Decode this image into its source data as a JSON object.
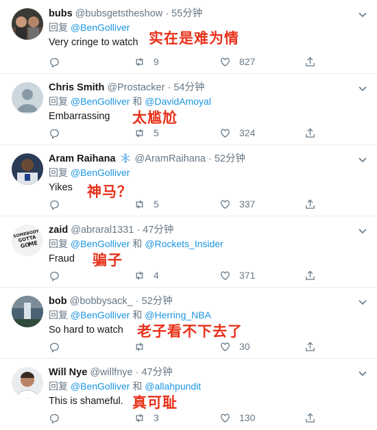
{
  "reply_prefix": "回复",
  "and_word": "和",
  "tweets": [
    {
      "name": "bubs",
      "handle": "@bubsgetstheshow",
      "time": "55分钟",
      "reply_to": [
        "@BenGolliver"
      ],
      "text": "Very cringe to watch",
      "overlay": "实在是难为情",
      "retweets": "9",
      "likes": "827"
    },
    {
      "name": "Chris Smith",
      "handle": "@Prostacker",
      "time": "54分钟",
      "reply_to": [
        "@BenGolliver",
        "@DavidAmoyal"
      ],
      "text": "Embarrassing",
      "overlay": "太尴尬",
      "retweets": "5",
      "likes": "324"
    },
    {
      "name": "Aram Raihana",
      "handle": "@AramRaihana",
      "time": "52分钟",
      "reply_to": [
        "@BenGolliver"
      ],
      "text": "Yikes",
      "overlay": "神马？",
      "retweets": "5",
      "likes": "337"
    },
    {
      "name": "zaid",
      "handle": "@abraral1331",
      "time": "47分钟",
      "reply_to": [
        "@BenGolliver",
        "@Rockets_Insider"
      ],
      "text": "Fraud",
      "overlay": "骗子",
      "retweets": "4",
      "likes": "371",
      "avatar_text": [
        "SOMEBODY",
        "GOTTA",
        "GO",
        "ME"
      ]
    },
    {
      "name": "bob",
      "handle": "@bobbysack_",
      "time": "52分钟",
      "reply_to": [
        "@BenGolliver",
        "@Herring_NBA"
      ],
      "text": "So hard to watch",
      "overlay": "老子看不下去了",
      "retweets": "",
      "likes": "30"
    },
    {
      "name": "Will Nye",
      "handle": "@willfnye",
      "time": "47分钟",
      "reply_to": [
        "@BenGolliver",
        "@allahpundit"
      ],
      "text": "This is shameful.",
      "overlay": "真可耻",
      "retweets": "3",
      "likes": "130"
    }
  ]
}
